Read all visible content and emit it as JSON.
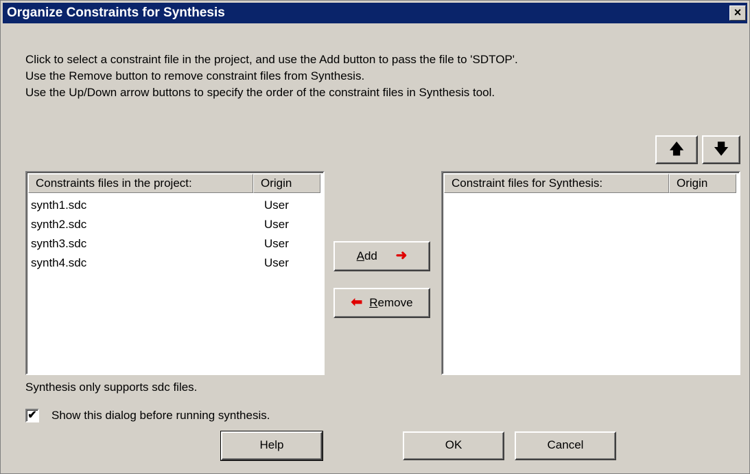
{
  "window": {
    "title": "Organize Constraints for Synthesis",
    "close_glyph": "×"
  },
  "instructions": [
    "Click to select a constraint file in the project, and use the Add button to pass the file to 'SDTOP'.",
    "Use the Remove button to remove constraint files from Synthesis.",
    "Use the Up/Down arrow buttons to specify the order of the constraint files in Synthesis tool."
  ],
  "left_list": {
    "columns": [
      "Constraints files in the project:",
      "Origin"
    ],
    "rows": [
      {
        "file": "synth1.sdc",
        "origin": "User"
      },
      {
        "file": "synth2.sdc",
        "origin": "User"
      },
      {
        "file": "synth3.sdc",
        "origin": "User"
      },
      {
        "file": "synth4.sdc",
        "origin": "User"
      }
    ]
  },
  "right_list": {
    "columns": [
      "Constraint files for Synthesis:",
      "Origin"
    ],
    "rows": []
  },
  "buttons": {
    "add_accel": "A",
    "add_rest": "dd",
    "add_arrow": "➜",
    "remove_arrow": "⬅",
    "remove_accel": "R",
    "remove_rest": "emove",
    "up_glyph": "🡅",
    "down_glyph": "🡇",
    "help": "Help",
    "ok": "OK",
    "cancel": "Cancel"
  },
  "note": "Synthesis only supports sdc files.",
  "show_dialog": {
    "label": "Show this dialog before running synthesis.",
    "checked_glyph": "✔"
  },
  "colors": {
    "title_bar": "#0a246a",
    "dialog_bg": "#d4d0c8",
    "arrow_red": "#e00000"
  }
}
